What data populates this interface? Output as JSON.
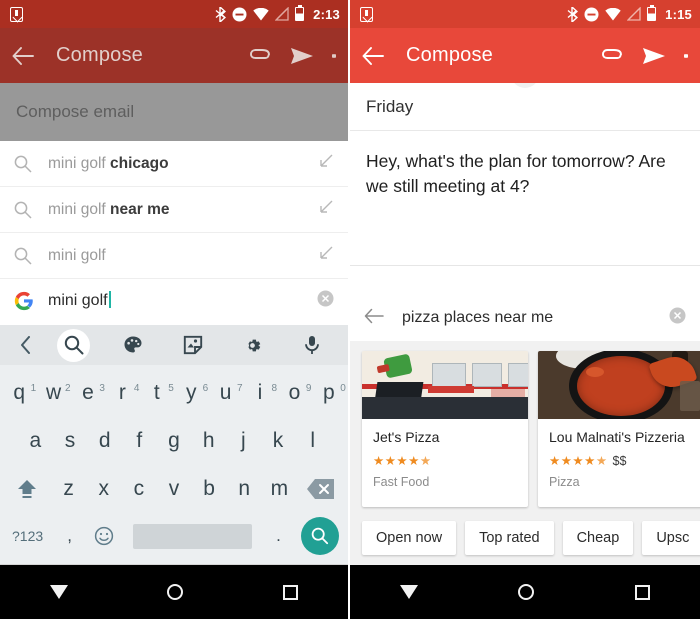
{
  "left": {
    "status": {
      "time": "2:13",
      "icons": [
        "save-icon",
        "bluetooth-icon",
        "do-not-disturb-icon",
        "wifi-icon",
        "signal-off-icon",
        "battery-icon"
      ]
    },
    "appbar": {
      "title": "Compose",
      "back": "back-arrow",
      "attach": "paperclip",
      "send": "send",
      "more": "overflow"
    },
    "compose_placeholder": "Compose email",
    "suggestions": [
      {
        "prefix": "mini golf ",
        "bold": "chicago"
      },
      {
        "prefix": "mini golf ",
        "bold": "near me"
      },
      {
        "prefix": "mini golf",
        "bold": ""
      }
    ],
    "search": {
      "value": "mini golf",
      "logo": "google-g",
      "clear": "clear-icon"
    },
    "keyboard": {
      "toolbar": [
        "back-chevron-icon",
        "search-icon",
        "palette-icon",
        "sticker-icon",
        "gear-icon",
        "mic-icon"
      ],
      "row1": [
        {
          "k": "q",
          "n": "1"
        },
        {
          "k": "w",
          "n": "2"
        },
        {
          "k": "e",
          "n": "3"
        },
        {
          "k": "r",
          "n": "4"
        },
        {
          "k": "t",
          "n": "5"
        },
        {
          "k": "y",
          "n": "6"
        },
        {
          "k": "u",
          "n": "7"
        },
        {
          "k": "i",
          "n": "8"
        },
        {
          "k": "o",
          "n": "9"
        },
        {
          "k": "p",
          "n": "0"
        }
      ],
      "row2": [
        "a",
        "s",
        "d",
        "f",
        "g",
        "h",
        "j",
        "k",
        "l"
      ],
      "row3": [
        "z",
        "x",
        "c",
        "v",
        "b",
        "n",
        "m"
      ],
      "shift": "shift-key",
      "backspace": "backspace-key",
      "symbols": "?123",
      "comma": ",",
      "emoji": "emoji-key",
      "space": "",
      "period": ".",
      "go": "search-go-key"
    }
  },
  "right": {
    "status": {
      "time": "1:15"
    },
    "appbar": {
      "title": "Compose"
    },
    "day": "Friday",
    "message": "Hey, what's the plan for tomorrow? Are we still meeting at 4?",
    "search": {
      "value": "pizza places near me",
      "back": "back-arrow",
      "clear": "clear-icon"
    },
    "cards": [
      {
        "name": "Jet's Pizza",
        "stars": "★★★★",
        "half": "★",
        "rating_text": "4.5",
        "price": "",
        "type": "Fast Food",
        "photo": "storefront-interior"
      },
      {
        "name": "Lou Malnati's Pizzeria",
        "stars": "★★★★",
        "half": "★",
        "rating_text": "4.5",
        "price": "$$",
        "type": "Pizza",
        "photo": "deep-dish-pizza-pan"
      }
    ],
    "chips": [
      "Open now",
      "Top rated",
      "Cheap",
      "Upsc"
    ]
  },
  "navbar": {
    "back": "nav-back-triangle",
    "home": "nav-home-circle",
    "recents": "nav-recents-square"
  },
  "colors": {
    "left_status": "#ab2f21",
    "left_appbar": "#9c3228",
    "right_status": "#d6402f",
    "right_appbar": "#e8483a",
    "accent_teal": "#21a094",
    "star_orange": "#ef8b20",
    "scrim_gray": "#989898"
  }
}
